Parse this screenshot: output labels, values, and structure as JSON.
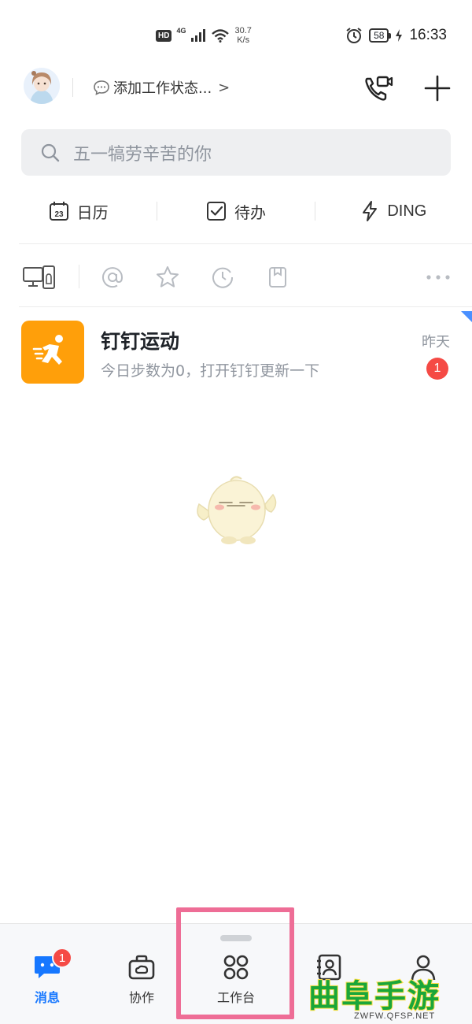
{
  "status_bar": {
    "hd": "HD",
    "network": "4G",
    "speed_value": "30.7",
    "speed_unit": "K/s",
    "battery": "58",
    "time": "16:33"
  },
  "header": {
    "status_text": "添加工作状态...",
    "status_chevron": ">"
  },
  "search": {
    "placeholder": "五一犒劳辛苦的你"
  },
  "quick_actions": [
    {
      "label": "日历",
      "icon": "calendar-icon",
      "day": "23"
    },
    {
      "label": "待办",
      "icon": "checkbox-icon"
    },
    {
      "label": "DING",
      "icon": "lightning-icon"
    }
  ],
  "filters": [
    "devices-icon",
    "at-icon",
    "star-icon",
    "clock-icon",
    "bookmark-icon",
    "more-icon"
  ],
  "conversation": {
    "title": "钉钉运动",
    "preview": "今日步数为0，打开钉钉更新一下",
    "time": "昨天",
    "unread": "1"
  },
  "tabs": [
    {
      "label": "消息",
      "icon": "message-icon",
      "badge": "1",
      "active": true
    },
    {
      "label": "协作",
      "icon": "briefcase-icon"
    },
    {
      "label": "工作台",
      "icon": "grid-icon"
    },
    {
      "label": "",
      "icon": "contacts-icon"
    },
    {
      "label": "",
      "icon": "profile-icon"
    }
  ],
  "watermark": {
    "text": "曲阜手游网",
    "url": "ZWFW.QFSP.NET"
  },
  "colors": {
    "accent": "#1677ff",
    "badge": "#f54a45",
    "sport_icon_bg": "#ff9f0a",
    "highlight_border": "#ee6d96"
  }
}
